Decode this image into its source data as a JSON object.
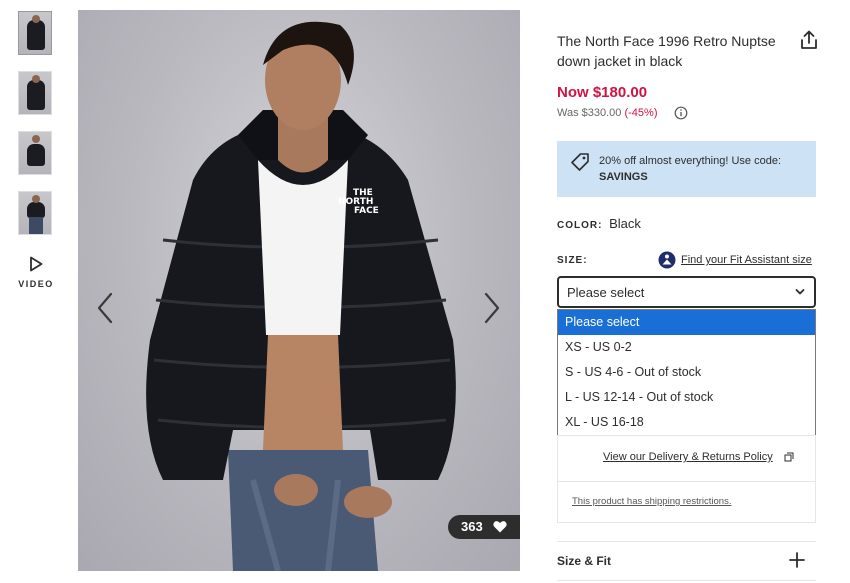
{
  "gallery": {
    "thumbnails": [
      "thumbnail-1",
      "thumbnail-2",
      "thumbnail-3",
      "thumbnail-4"
    ],
    "video_label": "VIDEO",
    "likes_count": "363",
    "photo_logo_lines": [
      "THE",
      "NORTH",
      "FACE"
    ]
  },
  "product": {
    "title": "The North Face 1996 Retro Nuptse down jacket in black",
    "price_now": "Now $180.00",
    "price_was": "Was $330.00",
    "discount": "(-45%)",
    "accent_color": "#d01345"
  },
  "promo": {
    "text": "20% off almost everything! Use code:",
    "code": "SAVINGS",
    "background": "#cde2f5"
  },
  "color": {
    "label": "COLOR:",
    "value": "Black"
  },
  "size": {
    "label": "SIZE:",
    "fit_assistant_link": "Find your Fit Assistant size",
    "selected": "Please select",
    "options": [
      "Please select",
      "XS - US 0-2",
      "S - US 4-6 - Out of stock",
      "L - US 12-14 - Out of stock",
      "XL - US 16-18"
    ],
    "highlight_color": "#1a6fd6"
  },
  "links": {
    "delivery": "View our Delivery & Returns Policy",
    "shipping": "This product has shipping restrictions."
  },
  "accordion": {
    "size_fit": "Size & Fit"
  },
  "icons": {
    "share": "share-icon",
    "info": "info-icon",
    "tag": "tag-icon",
    "fit": "fit-assistant-icon",
    "chevron": "chevron-down-icon",
    "external": "external-link-icon",
    "plus": "plus-icon",
    "heart": "heart-icon",
    "play": "play-icon",
    "prev": "chevron-left-icon",
    "next": "chevron-right-icon"
  }
}
